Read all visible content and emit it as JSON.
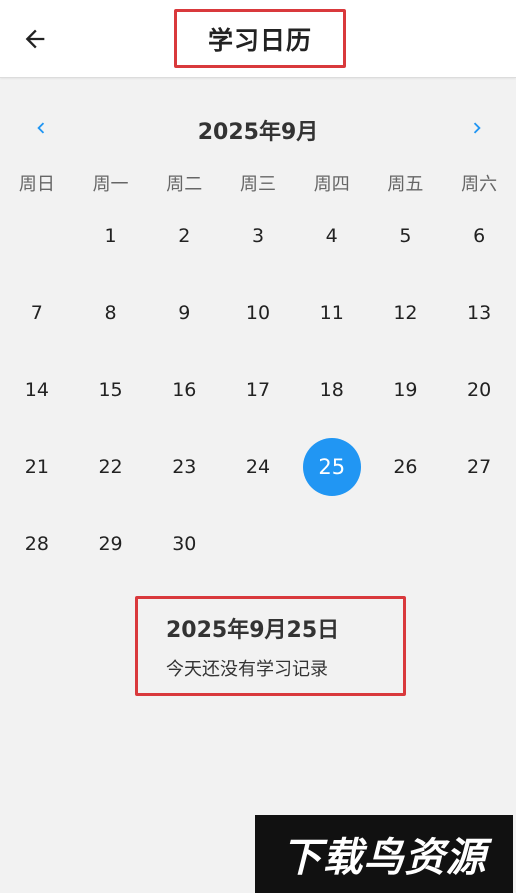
{
  "appbar": {
    "title": "学习日历"
  },
  "calendar": {
    "month_label": "2025年9月",
    "weekdays": [
      "周日",
      "周一",
      "周二",
      "周三",
      "周四",
      "周五",
      "周六"
    ],
    "leading_blanks": 1,
    "days": [
      "1",
      "2",
      "3",
      "4",
      "5",
      "6",
      "7",
      "8",
      "9",
      "10",
      "11",
      "12",
      "13",
      "14",
      "15",
      "16",
      "17",
      "18",
      "19",
      "20",
      "21",
      "22",
      "23",
      "24",
      "25",
      "26",
      "27",
      "28",
      "29",
      "30"
    ],
    "selected_day": "25",
    "selected_color": "#2196f3"
  },
  "record": {
    "date": "2025年9月25日",
    "message": "今天还没有学习记录"
  },
  "watermark": {
    "text": "下载鸟资源"
  },
  "colors": {
    "accent": "#2196f3",
    "highlight_border": "#d9393c",
    "background": "#f2f2f2"
  }
}
